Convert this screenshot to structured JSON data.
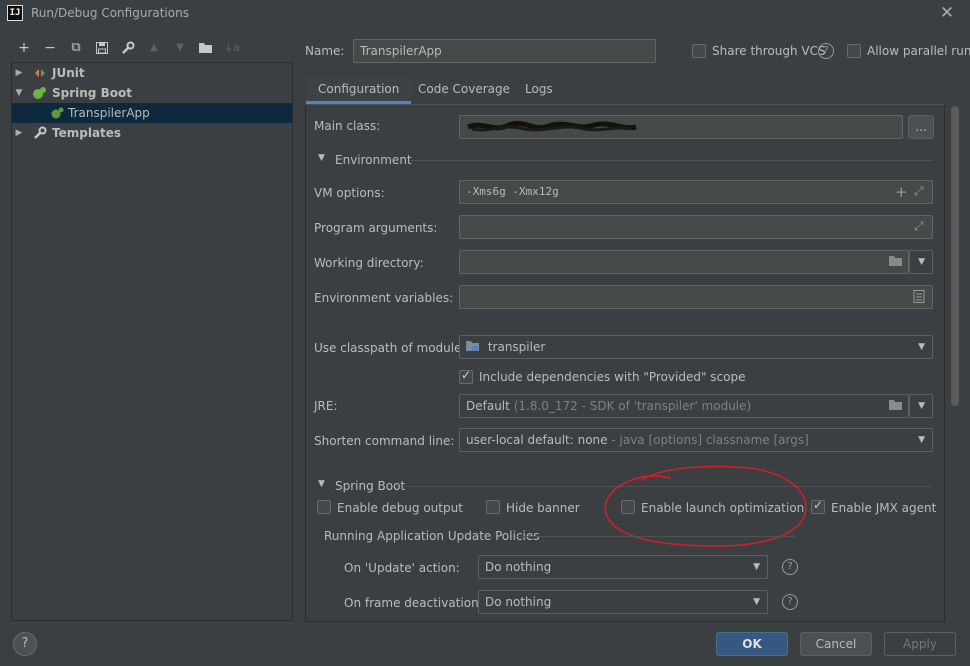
{
  "window": {
    "title": "Run/Debug Configurations",
    "app_icon_text": "IJ"
  },
  "toolbar": {
    "add": "+",
    "remove": "−",
    "copy": "⧉",
    "save": "💾",
    "edit": "🔧",
    "move_up": "▲",
    "move_down": "▼",
    "folder": "📁",
    "sort": "↓a"
  },
  "tree": {
    "items": [
      {
        "label": "JUnit",
        "expanded": false,
        "level": 0
      },
      {
        "label": "Spring Boot",
        "expanded": true,
        "level": 0
      },
      {
        "label": "TranspilerApp",
        "level": 1,
        "selected": true
      },
      {
        "label": "Templates",
        "expanded": false,
        "level": 0
      }
    ]
  },
  "header": {
    "name_label": "Name:",
    "name_value": "TranspilerApp",
    "share_vcs_label": "Share through VCS",
    "allow_parallel_label": "Allow parallel run"
  },
  "tabs": [
    {
      "label": "Configuration",
      "active": true
    },
    {
      "label": "Code Coverage",
      "active": false
    },
    {
      "label": "Logs",
      "active": false
    }
  ],
  "form": {
    "main_class_label": "Main class:",
    "main_class_value": "",
    "browse_label": "...",
    "environment_section": "Environment",
    "vm_options_label": "VM options:",
    "vm_options_value": "-Xms6g -Xmx12g",
    "program_args_label": "Program arguments:",
    "working_dir_label": "Working directory:",
    "env_vars_label": "Environment variables:",
    "classpath_label": "Use classpath of module:",
    "classpath_value": "transpiler",
    "include_deps_label": "Include dependencies with \"Provided\" scope",
    "jre_label": "JRE:",
    "jre_value": "Default",
    "jre_detail": "(1.8.0_172 - SDK of 'transpiler' module)",
    "shorten_label": "Shorten command line:",
    "shorten_value": "user-local default: none",
    "shorten_detail": "- java [options] classname [args]"
  },
  "spring_boot": {
    "section": "Spring Boot",
    "enable_debug_label": "Enable debug output",
    "hide_banner_label": "Hide banner",
    "launch_opt_label": "Enable launch optimization",
    "jmx_label": "Enable JMX agent",
    "policies_label": "Running Application Update Policies",
    "on_update_label": "On 'Update' action:",
    "on_update_value": "Do nothing",
    "on_frame_label": "On frame deactivation:",
    "on_frame_value": "Do nothing"
  },
  "footer": {
    "help": "?",
    "ok": "OK",
    "cancel": "Cancel",
    "apply": "Apply"
  },
  "colors": {
    "background": "#3c3f41",
    "selection": "#0d293e",
    "accent": "#4a88c7",
    "annotation": "#d0202a"
  }
}
